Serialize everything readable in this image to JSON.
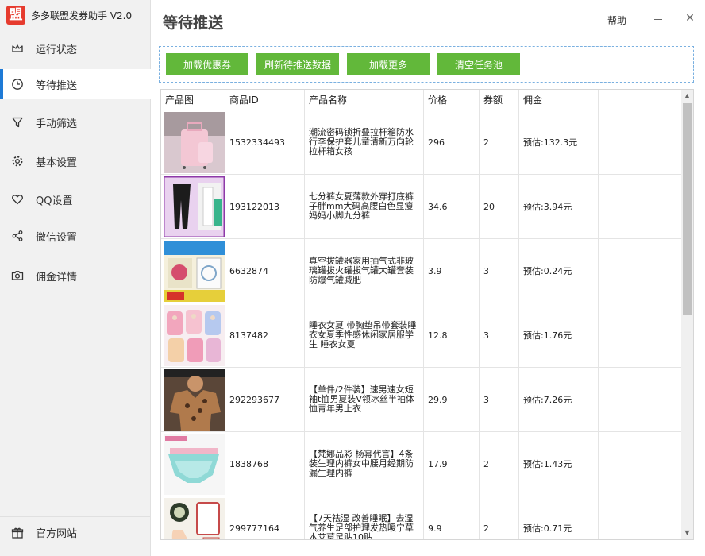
{
  "app": {
    "logo_char": "盟",
    "title": "多多联盟发券助手 V2.0",
    "accent": "#1e7ad6",
    "logo_color": "#e63b2e"
  },
  "sidebar": {
    "items": [
      {
        "label": "运行状态",
        "icon": "gauge-icon"
      },
      {
        "label": "等待推送",
        "icon": "clock-icon",
        "active": true
      },
      {
        "label": "手动筛选",
        "icon": "filter-icon"
      },
      {
        "label": "基本设置",
        "icon": "gear-icon"
      },
      {
        "label": "QQ设置",
        "icon": "heart-icon"
      },
      {
        "label": "微信设置",
        "icon": "share-icon"
      },
      {
        "label": "佣金详情",
        "icon": "camera-icon"
      }
    ],
    "footer": {
      "label": "官方网站",
      "icon": "gift-icon"
    }
  },
  "header": {
    "title": "等待推送",
    "help_label": "帮助",
    "minimize_glyph": "–",
    "close_glyph": "✕"
  },
  "toolbar": {
    "button_color": "#62b83a",
    "buttons": [
      "加载优惠券",
      "刷新待推送数据",
      "加载更多",
      "清空任务池"
    ]
  },
  "table": {
    "columns": [
      "产品图",
      "商品ID",
      "产品名称",
      "价格",
      "券额",
      "佣金"
    ],
    "rows": [
      {
        "id": "1532334493",
        "name": "潮流密码锁折叠拉杆箱防水行李保护套儿童清新万向轮拉杆箱女孩",
        "price": "296",
        "coupon": "2",
        "commission": "预估:132.3元",
        "thumb": "luggage-product-photo"
      },
      {
        "id": "193122013",
        "name": "七分裤女夏薄款外穿打底裤子胖mm大码高腰白色显瘦妈妈小脚九分裤",
        "price": "34.6",
        "coupon": "20",
        "commission": "预估:3.94元",
        "thumb": "leggings-product-photo"
      },
      {
        "id": "6632874",
        "name": "真空拔罐器家用抽气式非玻璃罐拔火罐拔气罐大罐套装防爆气罐减肥",
        "price": "3.9",
        "coupon": "3",
        "commission": "预估:0.24元",
        "thumb": "cupping-set-product-photo"
      },
      {
        "id": "8137482",
        "name": "睡衣女夏 带胸垫吊带套装睡衣女夏季性感休闲家居服学生 睡衣女夏",
        "price": "12.8",
        "coupon": "3",
        "commission": "预估:1.76元",
        "thumb": "pajamas-product-photo"
      },
      {
        "id": "292293677",
        "name": "【单件/2件装】速男速女短袖t恤男夏装V领冰丝半袖体恤青年男上衣",
        "price": "29.9",
        "coupon": "3",
        "commission": "预估:7.26元",
        "thumb": "tshirt-product-photo"
      },
      {
        "id": "1838768",
        "name": "【梵娜品彩 杨幂代言】4条装生理内裤女中腰月经期防漏生理内裤",
        "price": "17.9",
        "coupon": "2",
        "commission": "预估:1.43元",
        "thumb": "underwear-product-photo"
      },
      {
        "id": "299777164",
        "name": "【7天祛湿 改善睡眠】去湿气养生足部护理发热暖宁草本艾草足贴10贴",
        "price": "9.9",
        "coupon": "2",
        "commission": "预估:0.71元",
        "thumb": "foot-patch-product-photo"
      }
    ]
  },
  "scrollbar": {
    "up_glyph": "▲",
    "down_glyph": "▼"
  }
}
